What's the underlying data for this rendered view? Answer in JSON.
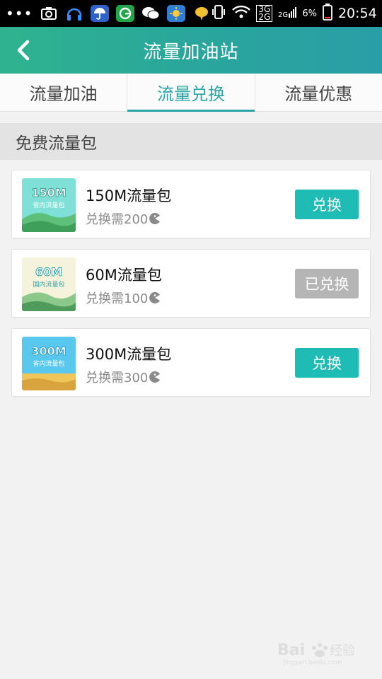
{
  "status_bar": {
    "overflow": "•••",
    "network_3g": "3G",
    "network_2g": "2G",
    "battery": "6%",
    "time": "20:54",
    "icons": [
      "overflow-icon",
      "screenshot-icon",
      "headset-icon",
      "umbrella-icon",
      "app-icon",
      "wechat-icon",
      "sun-icon",
      "chat-bubble-icon",
      "vibrate-icon",
      "wifi-icon",
      "signal-icon",
      "battery-icon"
    ]
  },
  "header": {
    "title": "流量加油站",
    "back_icon": "back-chevron-icon"
  },
  "tabs": [
    {
      "label": "流量加油",
      "active": false
    },
    {
      "label": "流量兑换",
      "active": true
    },
    {
      "label": "流量优惠",
      "active": false
    }
  ],
  "section": {
    "title": "免费流量包"
  },
  "packages": [
    {
      "thumb_size": "150M",
      "thumb_scope": "省内流量包",
      "title": "150M流量包",
      "cost": "兑换需200",
      "button": "兑换",
      "redeemed": false,
      "thumb_colors": [
        "#71ded5",
        "#3ea25c"
      ]
    },
    {
      "thumb_size": "60M",
      "thumb_scope": "国内流量包",
      "title": "60M流量包",
      "cost": "兑换需100",
      "button": "已兑换",
      "redeemed": true,
      "thumb_colors": [
        "#f4f1dc",
        "#6ab071"
      ]
    },
    {
      "thumb_size": "300M",
      "thumb_scope": "省内流量包",
      "title": "300M流量包",
      "cost": "兑换需300",
      "button": "兑换",
      "redeemed": false,
      "thumb_colors": [
        "#55c6ef",
        "#e0b245"
      ]
    }
  ],
  "colors": {
    "accent": "#2aa6a6",
    "button": "#1fbcb5",
    "button_done": "#b5b5b5"
  },
  "watermark": {
    "brand": "Bai",
    "brand_cn": "经验",
    "url": "jingyan.baidu.com"
  }
}
